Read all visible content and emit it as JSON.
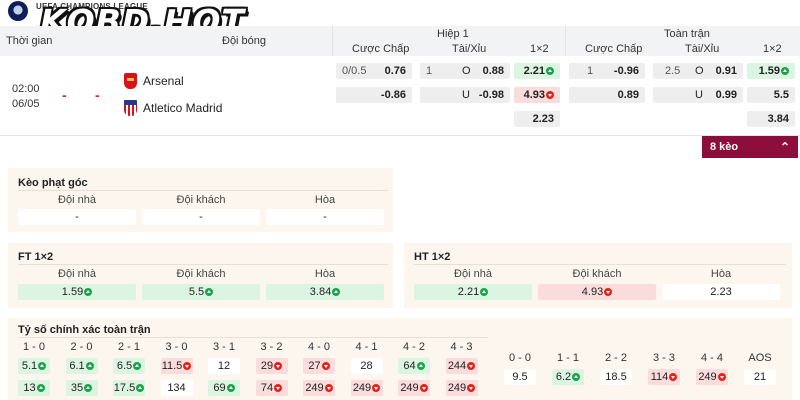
{
  "header": {
    "league": "UEFA CHAMPIONS LEAGUE",
    "brand": "KQBD.HOT",
    "col_time": "Thời gian",
    "col_teams": "Đội bóng",
    "half1": "Hiệp 1",
    "full": "Toàn trận",
    "sub": {
      "handicap": "Cược Chấp",
      "ou": "Tài/Xỉu",
      "x12": "1×2"
    }
  },
  "match": {
    "time": "02:00",
    "date": "06/05",
    "dash1": "-",
    "dash2": "-",
    "home": "Arsenal",
    "away": "Atletico Madrid",
    "h1": {
      "hc_line": "0/0.5",
      "hc_home": "0.76",
      "hc_away": "-0.86",
      "ou_line": "1",
      "ou_o": "O",
      "ou_over": "0.88",
      "ou_u": "U",
      "ou_under": "-0.98",
      "x1": "2.21",
      "x2": "4.93",
      "xd": "2.23"
    },
    "ft": {
      "hc_line": "1",
      "hc_home": "-0.96",
      "hc_away": "0.89",
      "ou_line": "2.5",
      "ou_o": "O",
      "ou_over": "0.91",
      "ou_u": "U",
      "ou_under": "0.99",
      "x1": "1.59",
      "x2": "5.5",
      "xd": "3.84"
    }
  },
  "more_button": {
    "label": "8 kèo",
    "chevron": "⌃"
  },
  "corner": {
    "title": "Kèo phạt góc",
    "heads": [
      "Đội nhà",
      "Đội khách",
      "Hòa"
    ],
    "values": [
      "-",
      "-",
      "-"
    ]
  },
  "ft12": {
    "title": "FT 1×2",
    "heads": [
      "Đội nhà",
      "Đội khách",
      "Hòa"
    ],
    "values": [
      "1.59",
      "5.5",
      "3.84"
    ]
  },
  "ht12": {
    "title": "HT 1×2",
    "heads": [
      "Đội nhà",
      "Đội khách",
      "Hòa"
    ],
    "values": [
      "2.21",
      "4.93",
      "2.23"
    ]
  },
  "correct_score": {
    "title": "Tỷ số chính xác toàn trận",
    "left_heads": [
      "1 - 0",
      "2 - 0",
      "2 - 1",
      "3 - 0",
      "3 - 1",
      "3 - 2",
      "4 - 0",
      "4 - 1",
      "4 - 2",
      "4 - 3"
    ],
    "row1": [
      "5.1",
      "6.1",
      "6.5",
      "11.5",
      "12",
      "29",
      "27",
      "28",
      "64",
      "244"
    ],
    "row2": [
      "13",
      "35",
      "17.5",
      "134",
      "69",
      "74",
      "249",
      "249",
      "249",
      "249"
    ],
    "right_heads": [
      "0 - 0",
      "1 - 1",
      "2 - 2",
      "3 - 3",
      "4 - 4",
      "AOS"
    ],
    "right_vals": [
      "9.5",
      "6.2",
      "18.5",
      "114",
      "249",
      "21"
    ]
  },
  "colors": {
    "accent": "#8d0e3a",
    "up": "#1aa34a",
    "down": "#e2231a",
    "green_bg": "#dcf5e3",
    "red_bg": "#fbdcdc"
  }
}
